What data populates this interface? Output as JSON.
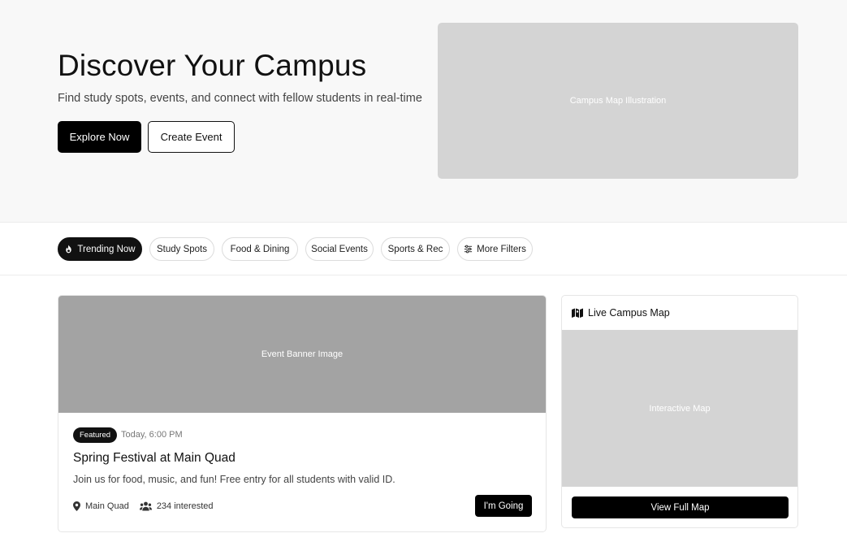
{
  "hero": {
    "title": "Discover Your Campus",
    "subtitle": "Find study spots, events, and connect with fellow students in real-time",
    "primary_button": "Explore Now",
    "secondary_button": "Create Event",
    "illustration_label": "Campus Map Illustration"
  },
  "filters": [
    {
      "label": "Trending Now",
      "icon": "fire-icon",
      "active": true
    },
    {
      "label": "Study Spots",
      "active": false
    },
    {
      "label": "Food & Dining",
      "active": false
    },
    {
      "label": "Social Events",
      "active": false
    },
    {
      "label": "Sports & Rec",
      "active": false
    },
    {
      "label": "More Filters",
      "icon": "sliders-icon",
      "active": false
    }
  ],
  "event": {
    "banner_label": "Event Banner Image",
    "badge": "Featured",
    "time": "Today, 6:00 PM",
    "title": "Spring Festival at Main Quad",
    "description": "Join us for food, music, and fun! Free entry for all students with valid ID.",
    "location": "Main Quad",
    "location_icon": "map-pin-icon",
    "interested": "234 interested",
    "interested_icon": "users-icon",
    "action_button": "I'm Going"
  },
  "map": {
    "title": "Live Campus Map",
    "title_icon": "map-icon",
    "area_label": "Interactive Map",
    "button": "View Full Map"
  },
  "colors": {
    "primary": "#000000",
    "hero_bg": "#f8f8f8",
    "placeholder_light": "#d4d4d4",
    "placeholder_dark": "#a3a3a3"
  }
}
